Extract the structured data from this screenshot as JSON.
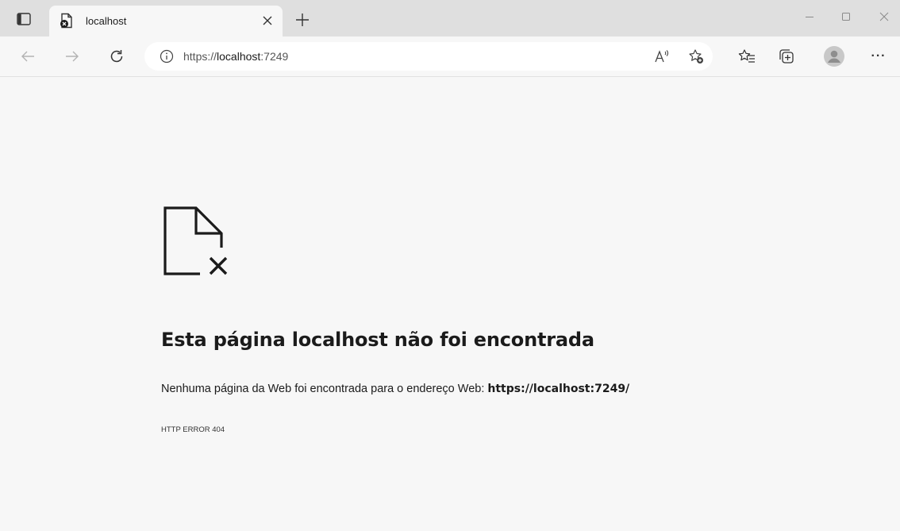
{
  "tab": {
    "title": "localhost",
    "close_label": "×"
  },
  "window_controls": [
    "minimize",
    "maximize",
    "close"
  ],
  "toolbar": {
    "url_scheme": "https://",
    "url_host": "localhost",
    "url_port": ":7249",
    "more_label": "···"
  },
  "error": {
    "headline": "Esta página localhost não foi encontrada",
    "description_prefix": "Nenhuma página da Web foi encontrada para o endereço Web: ",
    "description_url": "https://localhost:7249/",
    "code": "HTTP ERROR 404"
  },
  "colors": {
    "tabstrip_bg": "#dfdfdf",
    "page_bg": "#f7f7f7",
    "text": "#1b1b1b"
  },
  "icons": [
    "tab-actions-icon",
    "page-error-favicon",
    "close-icon",
    "plus-icon",
    "minimize-icon",
    "maximize-icon",
    "window-close-icon",
    "back-arrow-icon",
    "forward-arrow-icon",
    "refresh-icon",
    "info-icon",
    "read-aloud-icon",
    "add-favorite-icon",
    "favorites-icon",
    "collections-icon",
    "profile-avatar-icon",
    "page-not-found-icon"
  ]
}
